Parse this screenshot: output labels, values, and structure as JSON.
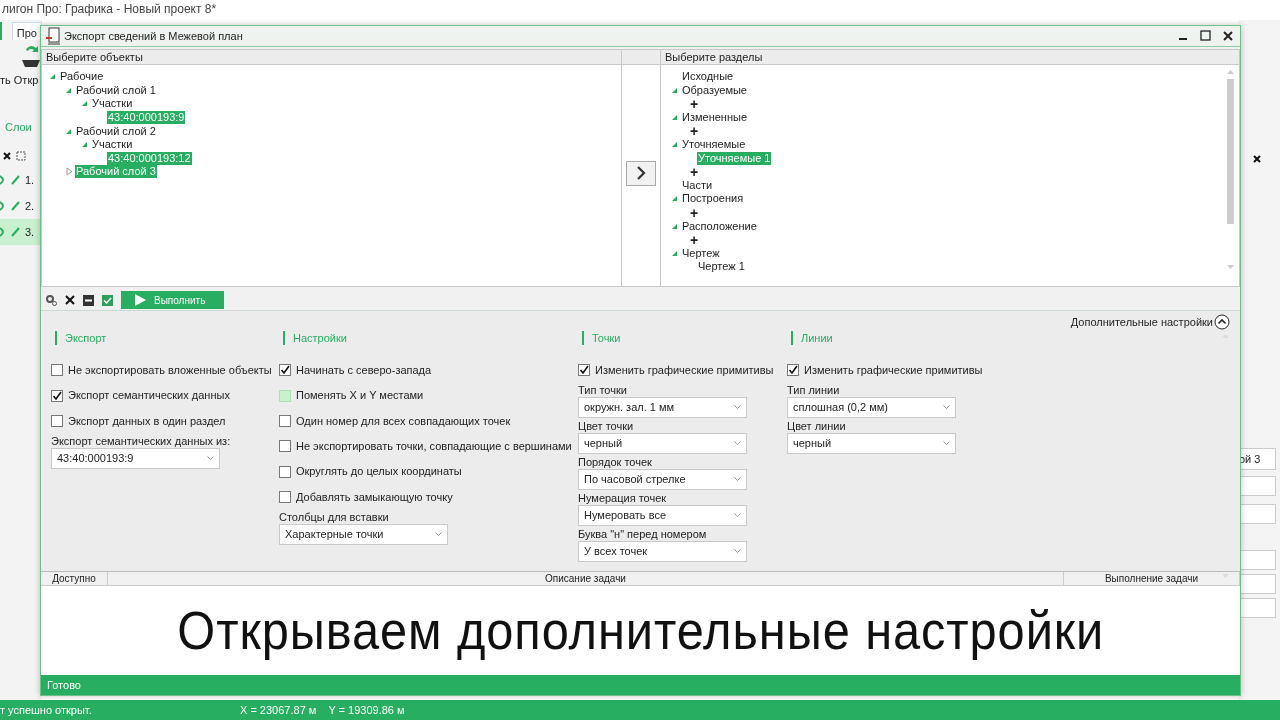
{
  "app": {
    "title": "лигон Про: Графика - Новый проект 8*",
    "tab": "Про",
    "ribbon_labels": [
      "ть",
      "Откр"
    ],
    "layers_tab": "Слои",
    "layers": [
      {
        "number": "1.",
        "selected": false
      },
      {
        "number": "2.",
        "selected": false
      },
      {
        "number": "3.",
        "selected": true
      }
    ],
    "side_field": "ой 3",
    "status_message": "т успешно открыт.",
    "coord_x": "X = 23067.87 м",
    "coord_y": "Y = 19309.86 м"
  },
  "dialog": {
    "title": "Экспорт сведений в Межевой план",
    "objects_panel": {
      "header": "Выберите объекты",
      "tree": [
        {
          "label": "Рабочие",
          "expanded": true,
          "selected": false,
          "children": [
            {
              "label": "Рабочий слой 1",
              "expanded": true,
              "selected": false,
              "children": [
                {
                  "label": "Участки",
                  "expanded": true,
                  "selected": false,
                  "children": [
                    {
                      "label": "43:40:000193:9",
                      "selected": true
                    }
                  ]
                }
              ]
            },
            {
              "label": "Рабочий слой 2",
              "expanded": true,
              "selected": false,
              "children": [
                {
                  "label": "Участки",
                  "expanded": true,
                  "selected": false,
                  "children": [
                    {
                      "label": "43:40:000193:12",
                      "selected": true
                    }
                  ]
                }
              ]
            },
            {
              "label": "Рабочий слой 3",
              "expanded": false,
              "selected": true
            }
          ]
        }
      ]
    },
    "sections_panel": {
      "header": "Выберите разделы",
      "tree": [
        {
          "label": "Исходные",
          "selected": false
        },
        {
          "label": "Образуемые",
          "expanded": true,
          "selected": false,
          "children": [
            {
              "kind": "add",
              "label": "+"
            }
          ]
        },
        {
          "label": "Измененные",
          "expanded": true,
          "selected": false,
          "children": [
            {
              "kind": "add",
              "label": "+"
            }
          ]
        },
        {
          "label": "Уточняемые",
          "expanded": true,
          "selected": false,
          "children": [
            {
              "label": "Уточняемые 1",
              "selected": true
            },
            {
              "kind": "add",
              "label": "+"
            }
          ]
        },
        {
          "label": "Части",
          "selected": false
        },
        {
          "label": "Построения",
          "expanded": true,
          "selected": false,
          "children": [
            {
              "kind": "add",
              "label": "+"
            }
          ]
        },
        {
          "label": "Расположение",
          "expanded": true,
          "selected": false,
          "children": [
            {
              "kind": "add",
              "label": "+"
            }
          ]
        },
        {
          "label": "Чертеж",
          "expanded": true,
          "selected": false,
          "children": [
            {
              "label": "Чертеж 1",
              "selected": false
            }
          ]
        }
      ]
    },
    "run_button": "Выполнить",
    "more_settings": {
      "label": "Дополнительные настройки",
      "expanded": true
    },
    "groups": [
      {
        "title": "Экспорт",
        "items": [
          {
            "kind": "checkbox",
            "label": "Не экспортировать вложенные объекты",
            "checked": false
          },
          {
            "kind": "checkbox",
            "label": "Экспорт семантических данных",
            "checked": true
          },
          {
            "kind": "checkbox",
            "label": "Экспорт данных в один раздел",
            "checked": false
          },
          {
            "kind": "dropdown",
            "label": "Экспорт семантических данных из:",
            "value": "43:40:000193:9"
          }
        ]
      },
      {
        "title": "Настройки",
        "items": [
          {
            "kind": "checkbox",
            "label": "Начинать с северо-запада",
            "checked": true
          },
          {
            "kind": "checkbox",
            "label": "Поменять X и Y местами",
            "checked": false,
            "hovered": true
          },
          {
            "kind": "checkbox",
            "label": "Один номер для всех совпадающих точек",
            "checked": false
          },
          {
            "kind": "checkbox",
            "label": "Не экспортировать точки, совпадающие с вершинами",
            "checked": false
          },
          {
            "kind": "checkbox",
            "label": "Округлять до целых координаты",
            "checked": false
          },
          {
            "kind": "checkbox",
            "label": "Добавлять замыкающую точку",
            "checked": false
          },
          {
            "kind": "dropdown",
            "label": "Столбцы для вставки",
            "value": "Характерные точки"
          }
        ]
      },
      {
        "title": "Точки",
        "items": [
          {
            "kind": "checkbox",
            "label": "Изменить графические примитивы",
            "checked": true
          },
          {
            "kind": "dropdown",
            "label": "Тип точки",
            "value": "окружн. зал. 1 мм"
          },
          {
            "kind": "dropdown",
            "label": "Цвет точки",
            "value": "черный"
          },
          {
            "kind": "dropdown",
            "label": "Порядок точек",
            "value": "По часовой стрелке"
          },
          {
            "kind": "dropdown",
            "label": "Нумерация точек",
            "value": "Нумеровать все"
          },
          {
            "kind": "dropdown",
            "label": "Буква \"н\" перед номером",
            "value": "У всех точек"
          }
        ]
      },
      {
        "title": "Линии",
        "items": [
          {
            "kind": "checkbox",
            "label": "Изменить графические примитивы",
            "checked": true
          },
          {
            "kind": "dropdown",
            "label": "Тип линии",
            "value": "сплошная (0,2 мм)"
          },
          {
            "kind": "dropdown",
            "label": "Цвет линии",
            "value": "черный"
          }
        ]
      }
    ],
    "task_columns": [
      "Доступно",
      "Описание задачи",
      "Выполнение задачи"
    ],
    "caption": "Открываем дополнительные настройки",
    "status": "Готово"
  }
}
